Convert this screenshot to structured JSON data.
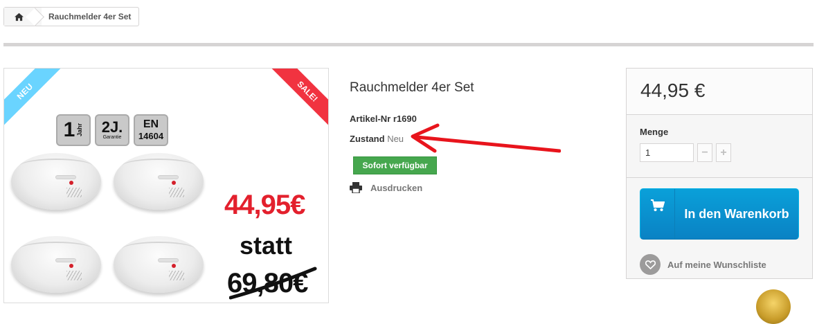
{
  "breadcrumb": {
    "home_icon": "home-icon",
    "current": "Rauchmelder 4er Set"
  },
  "product_image": {
    "ribbon_new": "NEU",
    "ribbon_sale": "SALE!",
    "badge_warranty_battery": {
      "number": "1",
      "unit": "Jahr"
    },
    "badge_warranty": {
      "text": "2J.",
      "sub": "Garantie"
    },
    "badge_norm": {
      "line1": "EN",
      "line2": "14604"
    },
    "price_new": "44,95€",
    "statt": "statt",
    "price_old": "69,80€",
    "colors": {
      "ribbon_new": "#6ad4ff",
      "ribbon_sale": "#f13340",
      "price_new": "#e3202d"
    }
  },
  "product": {
    "title": "Rauchmelder 4er Set",
    "reference_label": "Artikel-Nr",
    "reference_value": "r1690",
    "condition_label": "Zustand",
    "condition_value": "Neu",
    "availability": "Sofort verfügbar",
    "print_label": "Ausdrucken",
    "print_icon": "printer-icon",
    "colors": {
      "availability": "#46a74e",
      "annotation_arrow": "#e8141c"
    }
  },
  "buybox": {
    "price": "44,95 €",
    "quantity_label": "Menge",
    "quantity_value": "1",
    "minus_label": "−",
    "plus_label": "+",
    "cart_button": "In den Warenkorb",
    "cart_icon": "shopping-cart-icon",
    "wishlist_label": "Auf meine Wunschliste",
    "wishlist_icon": "heart-icon",
    "colors": {
      "cart_button": "#0a92cf"
    }
  }
}
